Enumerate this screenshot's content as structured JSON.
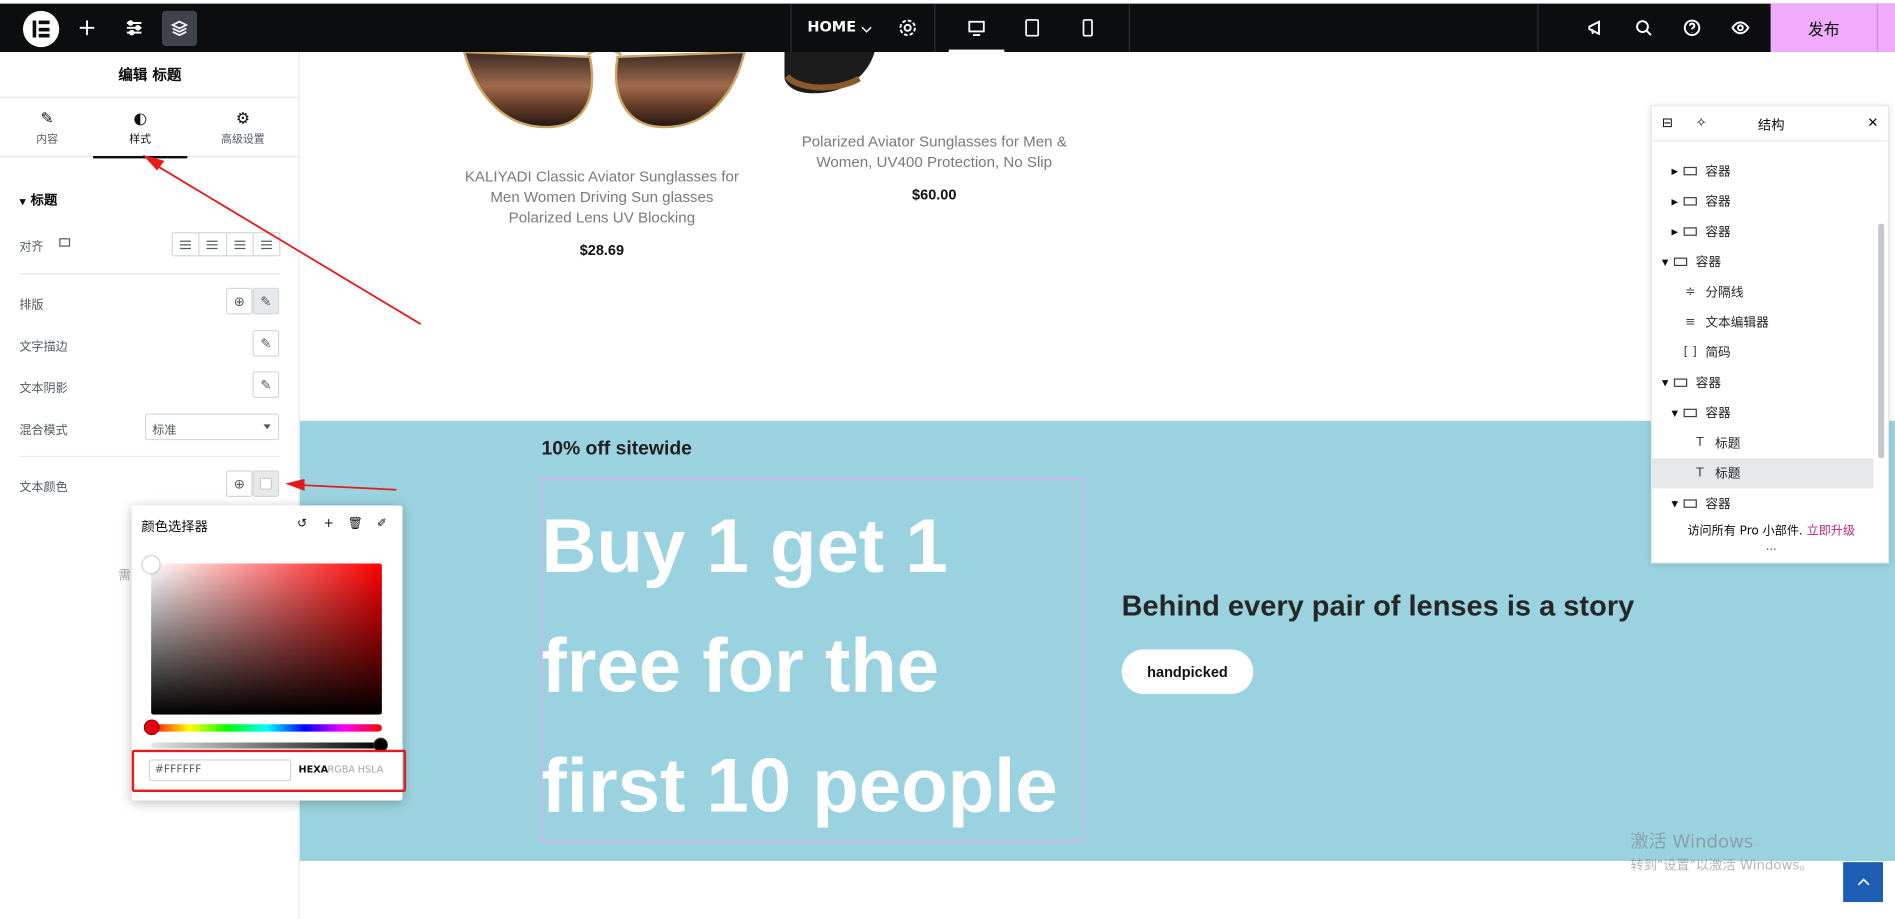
{
  "topbar": {
    "page_name": "HOME",
    "publish_label": "发布"
  },
  "panel": {
    "title": "编辑 标题",
    "tabs": [
      {
        "label": "内容",
        "icon": "pencil-icon"
      },
      {
        "label": "样式",
        "icon": "contrast-icon"
      },
      {
        "label": "高级设置",
        "icon": "gear-icon"
      }
    ],
    "active_tab": "样式",
    "section": "标题",
    "controls": {
      "align_label": "对齐",
      "typography_label": "排版",
      "text_stroke_label": "文字描边",
      "text_shadow_label": "文本阴影",
      "blend_mode_label": "混合模式",
      "blend_mode_value": "标准",
      "text_color_label": "文本颜色",
      "hidden_hint": "需"
    }
  },
  "color_picker": {
    "title": "颜色选择器",
    "hex_value": "#FFFFFF",
    "formats": [
      "HEXA",
      "RGBA",
      "HSLA"
    ],
    "active_format": "HEXA"
  },
  "products": [
    {
      "title": "KALIYADI Classic Aviator Sunglasses for Men Women Driving Sun glasses Polarized Lens UV Blocking",
      "price": "$28.69"
    },
    {
      "title": "Polarized Aviator Sunglasses for Men & Women, UV400 Protection, No Slip",
      "price": "$60.00"
    }
  ],
  "promo": {
    "eyebrow": "10% off sitewide",
    "headline": "Buy 1 get 1 free for the first 10 people",
    "story": "Behind every pair of lenses is a story",
    "button": "handpicked",
    "background": "#9ad3df"
  },
  "navigator": {
    "title": "结构",
    "rows": [
      {
        "label": "容器",
        "type": "container",
        "caret": "right",
        "indent": 1
      },
      {
        "label": "容器",
        "type": "container",
        "caret": "right",
        "indent": 1
      },
      {
        "label": "容器",
        "type": "container",
        "caret": "right",
        "indent": 1
      },
      {
        "label": "容器",
        "type": "container",
        "caret": "down",
        "indent": 0
      },
      {
        "label": "分隔线",
        "type": "divider",
        "caret": "",
        "indent": 1
      },
      {
        "label": "文本编辑器",
        "type": "text-editor",
        "caret": "",
        "indent": 1
      },
      {
        "label": "简码",
        "type": "shortcode",
        "caret": "",
        "indent": 1
      },
      {
        "label": "容器",
        "type": "container",
        "caret": "down",
        "indent": 0
      },
      {
        "label": "容器",
        "type": "container",
        "caret": "down",
        "indent": 1
      },
      {
        "label": "标题",
        "type": "heading",
        "caret": "",
        "indent": 2
      },
      {
        "label": "标题",
        "type": "heading",
        "caret": "",
        "indent": 2,
        "selected": true
      },
      {
        "label": "容器",
        "type": "container",
        "caret": "down",
        "indent": 1
      }
    ],
    "footer_text": "访问所有 Pro 小部件. ",
    "footer_link": "立即升级"
  },
  "watermark": {
    "line1": "激活 Windows",
    "line2": "转到\"设置\"以激活 Windows。"
  }
}
